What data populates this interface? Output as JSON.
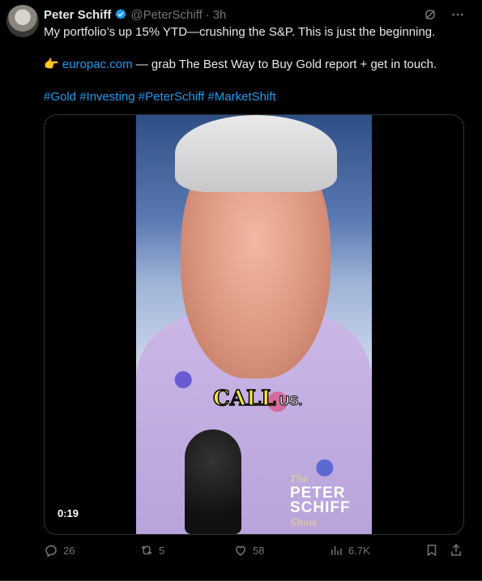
{
  "author": {
    "name": "Peter Schiff",
    "handle": "@PeterSchiff",
    "time_separator": "·",
    "time": "3h"
  },
  "tweet": {
    "line1": "My portfolio’s up 15% YTD—crushing the S&P. This is just the beginning.",
    "line2_emoji": "👉",
    "line2_link": "europac.com",
    "line2_rest": " — grab The Best Way to Buy Gold report + get in touch.",
    "hashtags": [
      "#Gold",
      "#Investing",
      "#PeterSchiff",
      "#MarketShift"
    ]
  },
  "media": {
    "caption_big": "CALL",
    "caption_small": "US.",
    "logo_line1": "The",
    "logo_line2": "PETER",
    "logo_line3": "SCHIFF",
    "logo_line4": "Show",
    "duration": "0:19"
  },
  "actions": {
    "replies": "26",
    "reposts": "5",
    "likes": "58",
    "views": "6.7K"
  },
  "icons": {
    "verified": "verified-badge-icon",
    "grok": "grok-icon",
    "more": "more-icon",
    "reply": "reply-icon",
    "repost": "repost-icon",
    "like": "like-icon",
    "views": "views-icon",
    "bookmark": "bookmark-icon",
    "share": "share-icon"
  },
  "colors": {
    "background": "#000000",
    "text": "#e7e9ea",
    "muted": "#71767b",
    "link": "#1d9bf0",
    "verified": "#1d9bf0"
  }
}
